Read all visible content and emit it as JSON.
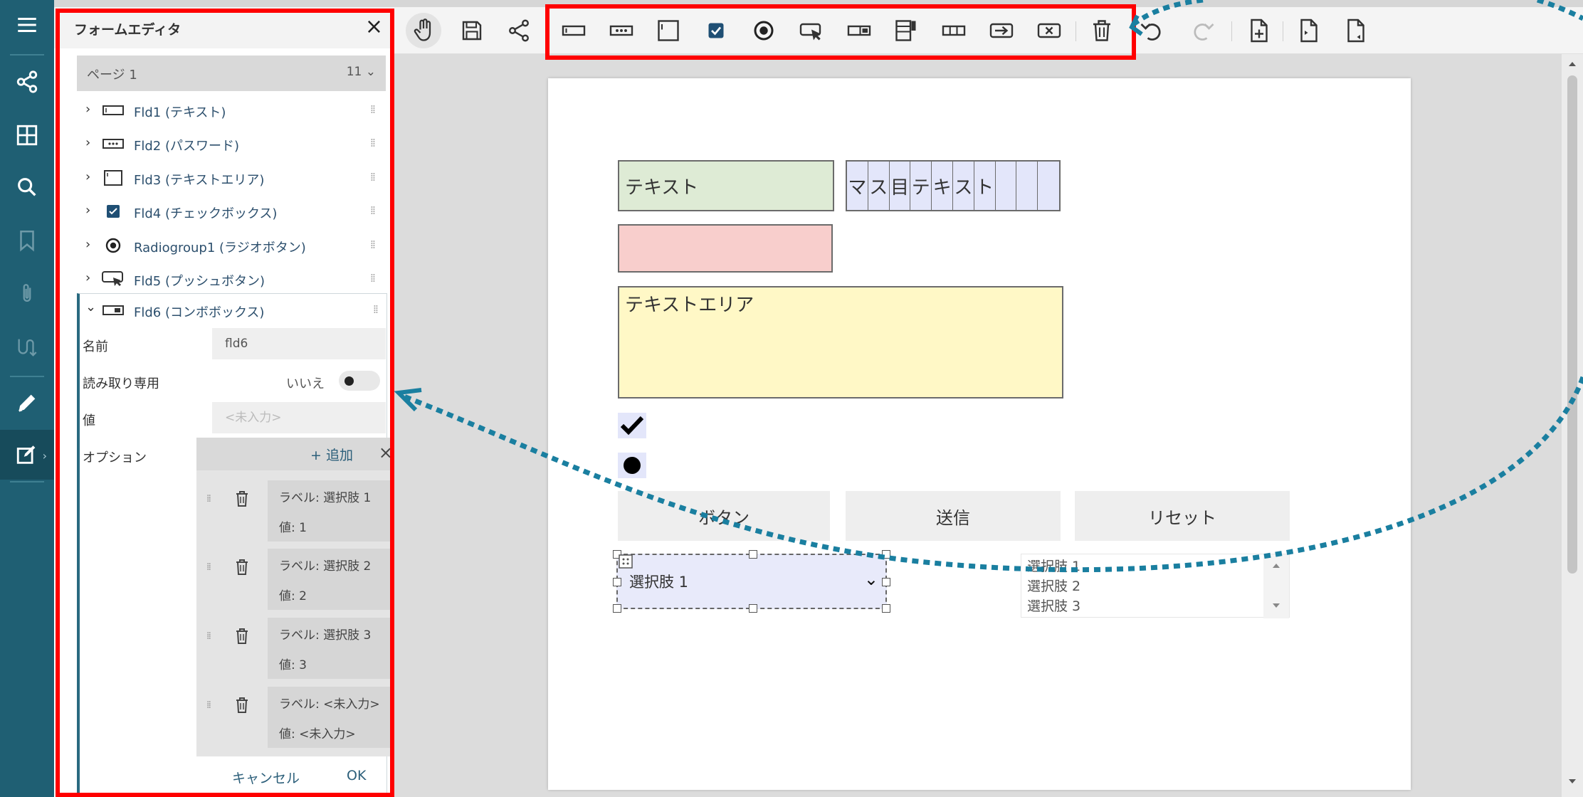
{
  "panel": {
    "title": "フォームエディタ",
    "close": "×",
    "page": {
      "label": "ページ 1",
      "count": "11 ⌄"
    },
    "fields": [
      {
        "label": "Fld1 (テキスト)",
        "icon": "text-field-icon"
      },
      {
        "label": "Fld2 (パスワード)",
        "icon": "password-field-icon"
      },
      {
        "label": "Fld3 (テキストエリア)",
        "icon": "textarea-icon"
      },
      {
        "label": "Fld4 (チェックボックス)",
        "icon": "checkbox-icon"
      },
      {
        "label": "Radiogroup1 (ラジオボタン)",
        "icon": "radio-icon"
      },
      {
        "label": "Fld5 (プッシュボタン)",
        "icon": "pushbutton-icon"
      }
    ],
    "expanded": {
      "label": "Fld6 (コンボボックス)",
      "name_label": "名前",
      "name_value": "fld6",
      "readonly_label": "読み取り専用",
      "readonly_value": "いいえ",
      "value_label": "値",
      "value_placeholder": "<未入力>",
      "options_label": "オプション",
      "add_label": "+ 追加",
      "clear": "×",
      "options": [
        {
          "label": "ラベル: 選択肢 1",
          "value": "値: 1"
        },
        {
          "label": "ラベル: 選択肢 2",
          "value": "値: 2"
        },
        {
          "label": "ラベル: 選択肢 3",
          "value": "値: 3"
        },
        {
          "label": "ラベル: <未入力>",
          "value": "値: <未入力>"
        }
      ],
      "cancel": "キャンセル",
      "ok": "OK"
    }
  },
  "form": {
    "text_value": "テキスト",
    "comb_chars": [
      "マ",
      "ス",
      "目",
      "テ",
      "キ",
      "ス",
      "ト",
      "",
      "",
      ""
    ],
    "textarea_value": "テキストエリア",
    "buttons": [
      "ボタン",
      "送信",
      "リセット"
    ],
    "combo_value": "選択肢 1",
    "combo_arrow": "⌄",
    "list_items": [
      "選択肢 1",
      "選択肢 2",
      "選択肢 3"
    ]
  },
  "colors": {
    "sidebar": "#1f5f73",
    "highlight": "#ff0000",
    "arrow": "#1a7fa0"
  },
  "toolbar_icons": [
    "hand-tool-icon",
    "save-icon",
    "share-icon",
    "add-text-field-icon",
    "add-password-field-icon",
    "add-textarea-icon",
    "add-checkbox-icon",
    "add-radio-icon",
    "add-pushbutton-icon",
    "add-combobox-icon",
    "add-listbox-icon",
    "add-comb-field-icon",
    "add-submit-button-icon",
    "add-reset-button-icon",
    "delete-icon",
    "undo-icon",
    "redo-icon",
    "add-page-icon",
    "page-before-icon",
    "page-after-icon"
  ]
}
